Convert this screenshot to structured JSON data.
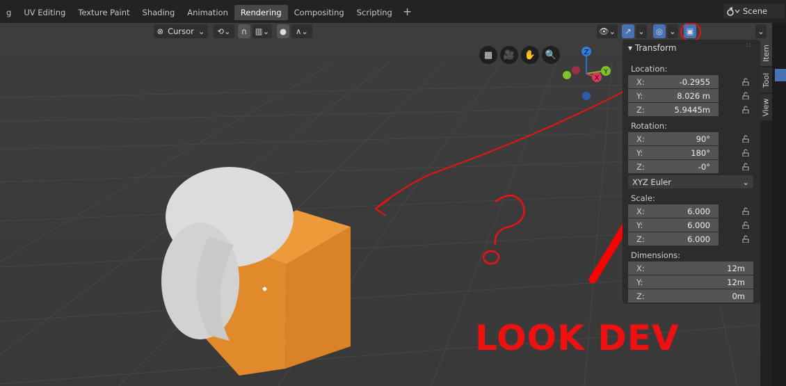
{
  "workspace_tabs": [
    "g",
    "UV Editing",
    "Texture Paint",
    "Shading",
    "Animation",
    "Rendering",
    "Compositing",
    "Scripting"
  ],
  "active_tab": "Rendering",
  "scene": {
    "label": "Scene"
  },
  "header": {
    "pivot_label": "Cursor"
  },
  "gizmo": {
    "z": "Z",
    "y": "Y",
    "x": "X"
  },
  "sidebar_tabs": [
    "Item",
    "Tool",
    "View"
  ],
  "transform": {
    "title": "Transform",
    "location_label": "Location:",
    "location": [
      {
        "axis": "X:",
        "value": "-0.2955"
      },
      {
        "axis": "Y:",
        "value": "8.026 m"
      },
      {
        "axis": "Z:",
        "value": "5.9445m"
      }
    ],
    "rotation_label": "Rotation:",
    "rotation": [
      {
        "axis": "X:",
        "value": "90°"
      },
      {
        "axis": "Y:",
        "value": "180°"
      },
      {
        "axis": "Z:",
        "value": "-0°"
      }
    ],
    "rotation_mode": "XYZ Euler",
    "scale_label": "Scale:",
    "scale": [
      {
        "axis": "X:",
        "value": "6.000"
      },
      {
        "axis": "Y:",
        "value": "6.000"
      },
      {
        "axis": "Z:",
        "value": "6.000"
      }
    ],
    "dimensions_label": "Dimensions:",
    "dimensions": [
      {
        "axis": "X:",
        "value": "12m"
      },
      {
        "axis": "Y:",
        "value": "12m"
      },
      {
        "axis": "Z:",
        "value": "0m"
      }
    ]
  },
  "annotation": {
    "text": "LOOK DEV",
    "color": "#ee1111"
  },
  "colors": {
    "accent": "#4772b3",
    "cube": "#e08a2c",
    "sphere": "#d6d6d6"
  }
}
